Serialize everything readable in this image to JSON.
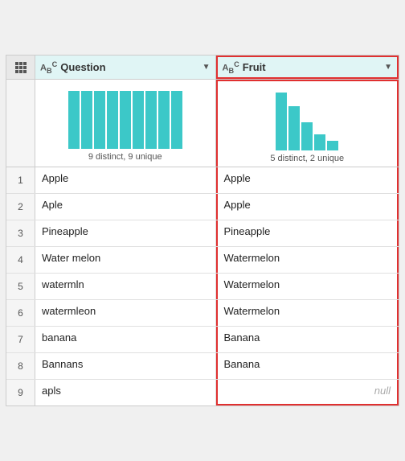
{
  "header": {
    "col1": {
      "icon": "ABC",
      "label": "Question",
      "arrow": "▼"
    },
    "col2": {
      "icon": "ABC",
      "label": "Fruit",
      "arrow": "▼"
    }
  },
  "chart": {
    "col1": {
      "label": "9 distinct, 9 unique",
      "bars": [
        72,
        72,
        72,
        72,
        72,
        72,
        72,
        72,
        72
      ]
    },
    "col2": {
      "label": "5 distinct, 2 unique",
      "bars": [
        72,
        55,
        35,
        20,
        12
      ]
    }
  },
  "rows": [
    {
      "num": "1",
      "question": "Apple",
      "fruit": "Apple",
      "null": false
    },
    {
      "num": "2",
      "question": "Aple",
      "fruit": "Apple",
      "null": false
    },
    {
      "num": "3",
      "question": "Pineapple",
      "fruit": "Pineapple",
      "null": false
    },
    {
      "num": "4",
      "question": "Water melon",
      "fruit": "Watermelon",
      "null": false
    },
    {
      "num": "5",
      "question": "watermln",
      "fruit": "Watermelon",
      "null": false
    },
    {
      "num": "6",
      "question": "watermleon",
      "fruit": "Watermelon",
      "null": false
    },
    {
      "num": "7",
      "question": "banana",
      "fruit": "Banana",
      "null": false
    },
    {
      "num": "8",
      "question": "Bannans",
      "fruit": "Banana",
      "null": false
    },
    {
      "num": "9",
      "question": "apls",
      "fruit": "null",
      "null": true
    }
  ]
}
